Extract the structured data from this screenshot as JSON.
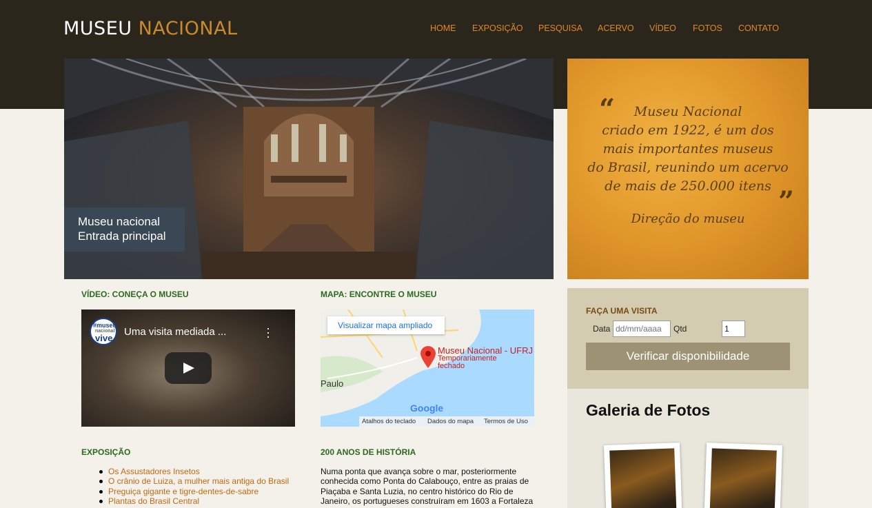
{
  "header": {
    "logo_part1": "MUSEU",
    "logo_part2": "NACIONAL",
    "nav": [
      "HOME",
      "EXPOSIÇÃO",
      "PESQUISA",
      "ACERVO",
      "VÍDEO",
      "FOTOS",
      "CONTATO"
    ]
  },
  "hero": {
    "caption_line1": "Museu nacional",
    "caption_line2": "Entrada principal"
  },
  "quote": {
    "open_mark": "“",
    "close_mark": "”",
    "lines": [
      "Museu Nacional",
      "criado em 1922, é um dos",
      "mais importantes museus",
      "do Brasil, reunindo um acervo",
      "de mais de 250.000 itens"
    ],
    "author": "Direção do museu"
  },
  "visit": {
    "title": "FAÇA UMA VISITA",
    "date_label": "Data",
    "date_placeholder": "dd/mm/aaaa",
    "qty_label": "Qtd pessoas",
    "qty_value": "1",
    "button": "Verificar disponibilidade"
  },
  "gallery": {
    "title": "Galeria de Fotos"
  },
  "video_section": {
    "title": "VÍDEO: CONEÇA O MUSEU",
    "video_title": "Uma visita mediada ...",
    "logo_top": "#museu",
    "logo_mid": "nacional",
    "logo_bottom": "vive"
  },
  "map_section": {
    "title": "MAPA: ENCONTRE O MUSEU",
    "enlarge_link": "Visualizar mapa ampliado",
    "place_name": "Museu Nacional - UFRJ",
    "place_status_1": "Temporariamente",
    "place_status_2": "fechado",
    "city_label": "Paulo",
    "brand": "Google",
    "footer": [
      "Atalhos do teclado",
      "Dados do mapa",
      "Termos de Uso"
    ]
  },
  "expo": {
    "title": "EXPOSIÇÃO",
    "items": [
      "Os Assustadores Insetos",
      "O crânio de Luiza, a mulher mais antiga do Brasil",
      "Preguiça gigante e tigre-dentes-de-sabre",
      "Plantas do Brasil Central"
    ]
  },
  "history": {
    "title": "200 ANOS DE HISTÓRIA",
    "text": "Numa ponta que avança sobre o mar, posteriormente conhecida como Ponta do Calabouço, entre as praias de Piaçaba e Santa Luzia, no centro histórico do Rio de Janeiro, os portugueses construíram em 1603 a Fortaleza"
  },
  "colors": {
    "header_bg": "#2b261b",
    "nav_accent": "#e0872a",
    "section_green": "#2b6a1d",
    "quote_bg": "#e39a2c",
    "visit_bg": "#d4ccb1",
    "button_bg": "#9d9273"
  }
}
